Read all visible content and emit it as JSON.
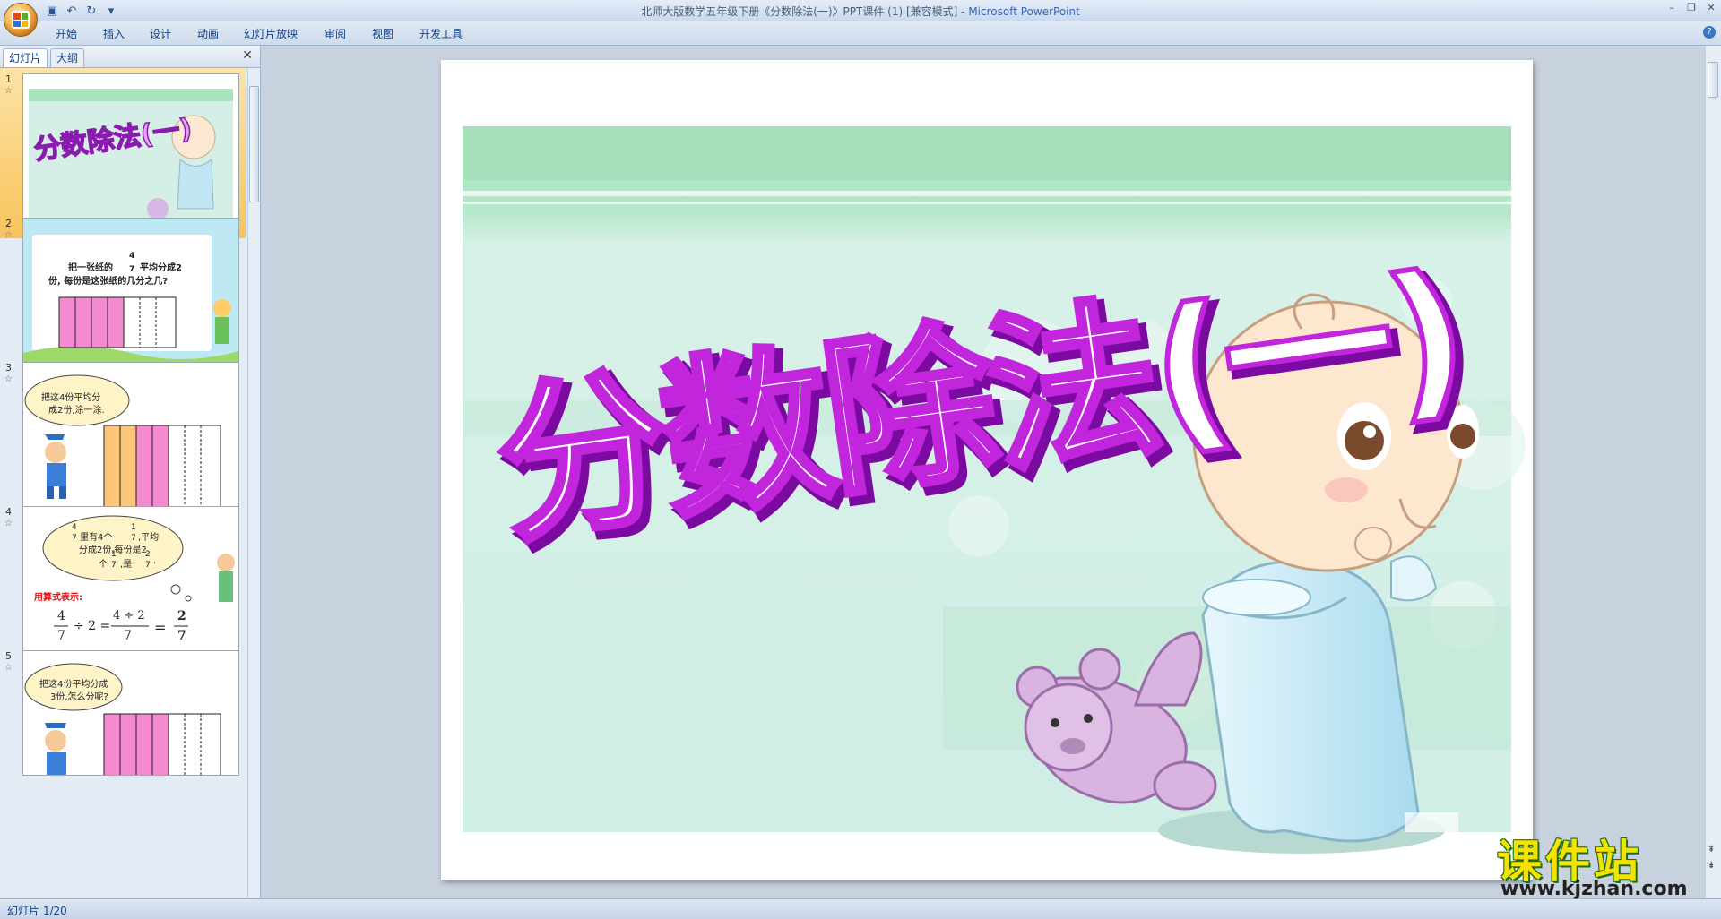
{
  "window": {
    "title_main": "北师大版数学五年级下册《分数除法(一)》PPT课件 (1) [兼容模式] - ",
    "title_app": "Microsoft PowerPoint"
  },
  "ribbon_tabs": [
    "开始",
    "插入",
    "设计",
    "动画",
    "幻灯片放映",
    "审阅",
    "视图",
    "开发工具"
  ],
  "pane": {
    "tabs": [
      "幻灯片",
      "大纲"
    ]
  },
  "slides": [
    {
      "num": "1",
      "star": "☆"
    },
    {
      "num": "2",
      "star": "☆",
      "text_a": "把一张纸的",
      "frac_n": "4",
      "frac_d": "7",
      "text_b": "平均分成2",
      "text_c": "份, 每份是这张纸的几分之几?"
    },
    {
      "num": "3",
      "star": "☆",
      "bubble_a": "把这4份平均分",
      "bubble_b": "成2份,涂一涂."
    },
    {
      "num": "4",
      "star": "☆",
      "line_a1": "4",
      "line_a1d": "7",
      "line_a2": "里有4个",
      "line_a3n": "1",
      "line_a3d": "7",
      "line_a4": ",平均",
      "line_b": "分成2份,每份是2",
      "line_c1": "个",
      "line_c2n": "1",
      "line_c2d": "7",
      "line_c3": ",是",
      "line_c4n": "2",
      "line_c4d": "7",
      "line_c5": ".",
      "formula_label": "用算式表示:",
      "f1n": "4",
      "f1d": "7",
      "f_div": "÷ 2 =",
      "f2n": "4 ÷ 2",
      "f2d": "7",
      "f_eq": "=",
      "f3n": "2",
      "f3d": "7"
    },
    {
      "num": "5",
      "star": "☆",
      "bubble_a": "把这4份平均分成",
      "bubble_b": "3份,怎么分呢?"
    }
  ],
  "main_slide": {
    "title": "分数除法(一)"
  },
  "status": {
    "slide_info": "幻灯片 1/20"
  },
  "watermark": {
    "main": "课件站",
    "sub": "www.kjzhan.com"
  }
}
